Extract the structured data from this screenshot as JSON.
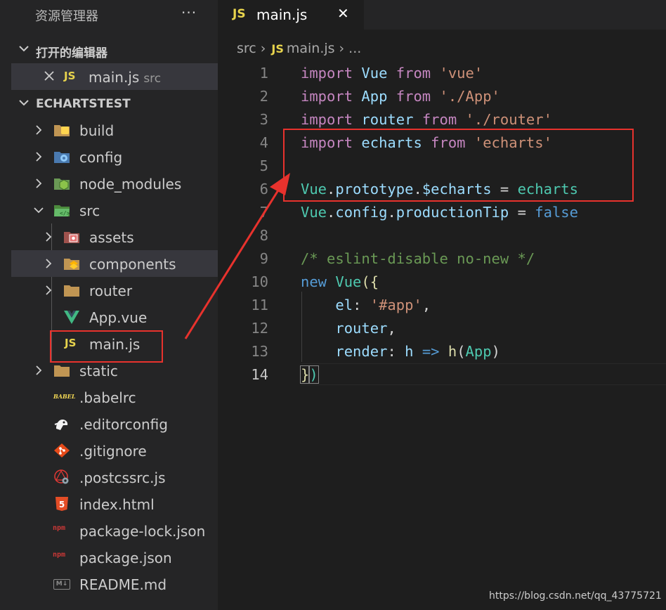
{
  "sidebar": {
    "title": "资源管理器",
    "more": "···",
    "open_editors": {
      "header": "打开的编辑器",
      "items": [
        {
          "name": "main.js",
          "desc": "src",
          "badge": "JS"
        }
      ]
    },
    "project": {
      "header": "ECHARTSTEST",
      "tree": [
        {
          "label": "build",
          "icon": "folder-build-icon"
        },
        {
          "label": "config",
          "icon": "folder-config-icon"
        },
        {
          "label": "node_modules",
          "icon": "folder-node-icon"
        },
        {
          "label": "src",
          "icon": "folder-src-icon"
        },
        {
          "label": "assets",
          "icon": "folder-assets-icon"
        },
        {
          "label": "components",
          "icon": "folder-components-icon"
        },
        {
          "label": "router",
          "icon": "folder-icon"
        },
        {
          "label": "App.vue",
          "icon": "vue-icon"
        },
        {
          "label": "main.js",
          "icon": "js-icon",
          "badge": "JS"
        },
        {
          "label": "static",
          "icon": "folder-icon"
        },
        {
          "label": ".babelrc",
          "icon": "babel-icon",
          "badge": "BABEL"
        },
        {
          "label": ".editorconfig",
          "icon": "editorconfig-icon"
        },
        {
          "label": ".gitignore",
          "icon": "git-icon"
        },
        {
          "label": ".postcssrc.js",
          "icon": "postcss-icon"
        },
        {
          "label": "index.html",
          "icon": "html5-icon",
          "badge": "5"
        },
        {
          "label": "package-lock.json",
          "icon": "npm-icon",
          "badge": "npm"
        },
        {
          "label": "package.json",
          "icon": "npm-icon",
          "badge": "npm"
        },
        {
          "label": "README.md",
          "icon": "markdown-icon",
          "badge": "M↓"
        }
      ]
    }
  },
  "editor": {
    "tab": {
      "title": "main.js",
      "badge": "JS",
      "close": "✕"
    },
    "breadcrumb": {
      "folder": "src",
      "file": "main.js",
      "rest": "...",
      "badge": "JS"
    },
    "current_line": 14,
    "line_numbers": [
      "1",
      "2",
      "3",
      "4",
      "5",
      "6",
      "7",
      "8",
      "9",
      "10",
      "11",
      "12",
      "13",
      "14"
    ],
    "code": {
      "l1": [
        "import",
        "Vue",
        "from",
        "'vue'"
      ],
      "l2": [
        "import",
        "App",
        "from",
        "'./App'"
      ],
      "l3": [
        "import",
        "router",
        "from",
        "'./router'"
      ],
      "l4": [
        "import",
        "echarts",
        "from",
        "'echarts'"
      ],
      "l6": [
        "Vue",
        ".",
        "prototype",
        ".",
        "$echarts",
        "=",
        "echarts"
      ],
      "l7": [
        "Vue",
        ".",
        "config",
        ".",
        "productionTip",
        "=",
        "false"
      ],
      "l9": "/* eslint-disable no-new */",
      "l10": [
        "new",
        "Vue",
        "({"
      ],
      "l11": [
        "el",
        ":",
        "'#app'",
        ","
      ],
      "l12": [
        "router",
        ","
      ],
      "l13": [
        "render",
        ":",
        "h",
        "=>",
        "h",
        "(",
        "App",
        ")"
      ],
      "l14": [
        "}",
        ")"
      ]
    }
  },
  "watermark": "https://blog.csdn.net/qq_43775721",
  "colors": {
    "annotation_red": "#e8322d",
    "js_yellow": "#e8d44d",
    "vue_green": "#41b883"
  }
}
